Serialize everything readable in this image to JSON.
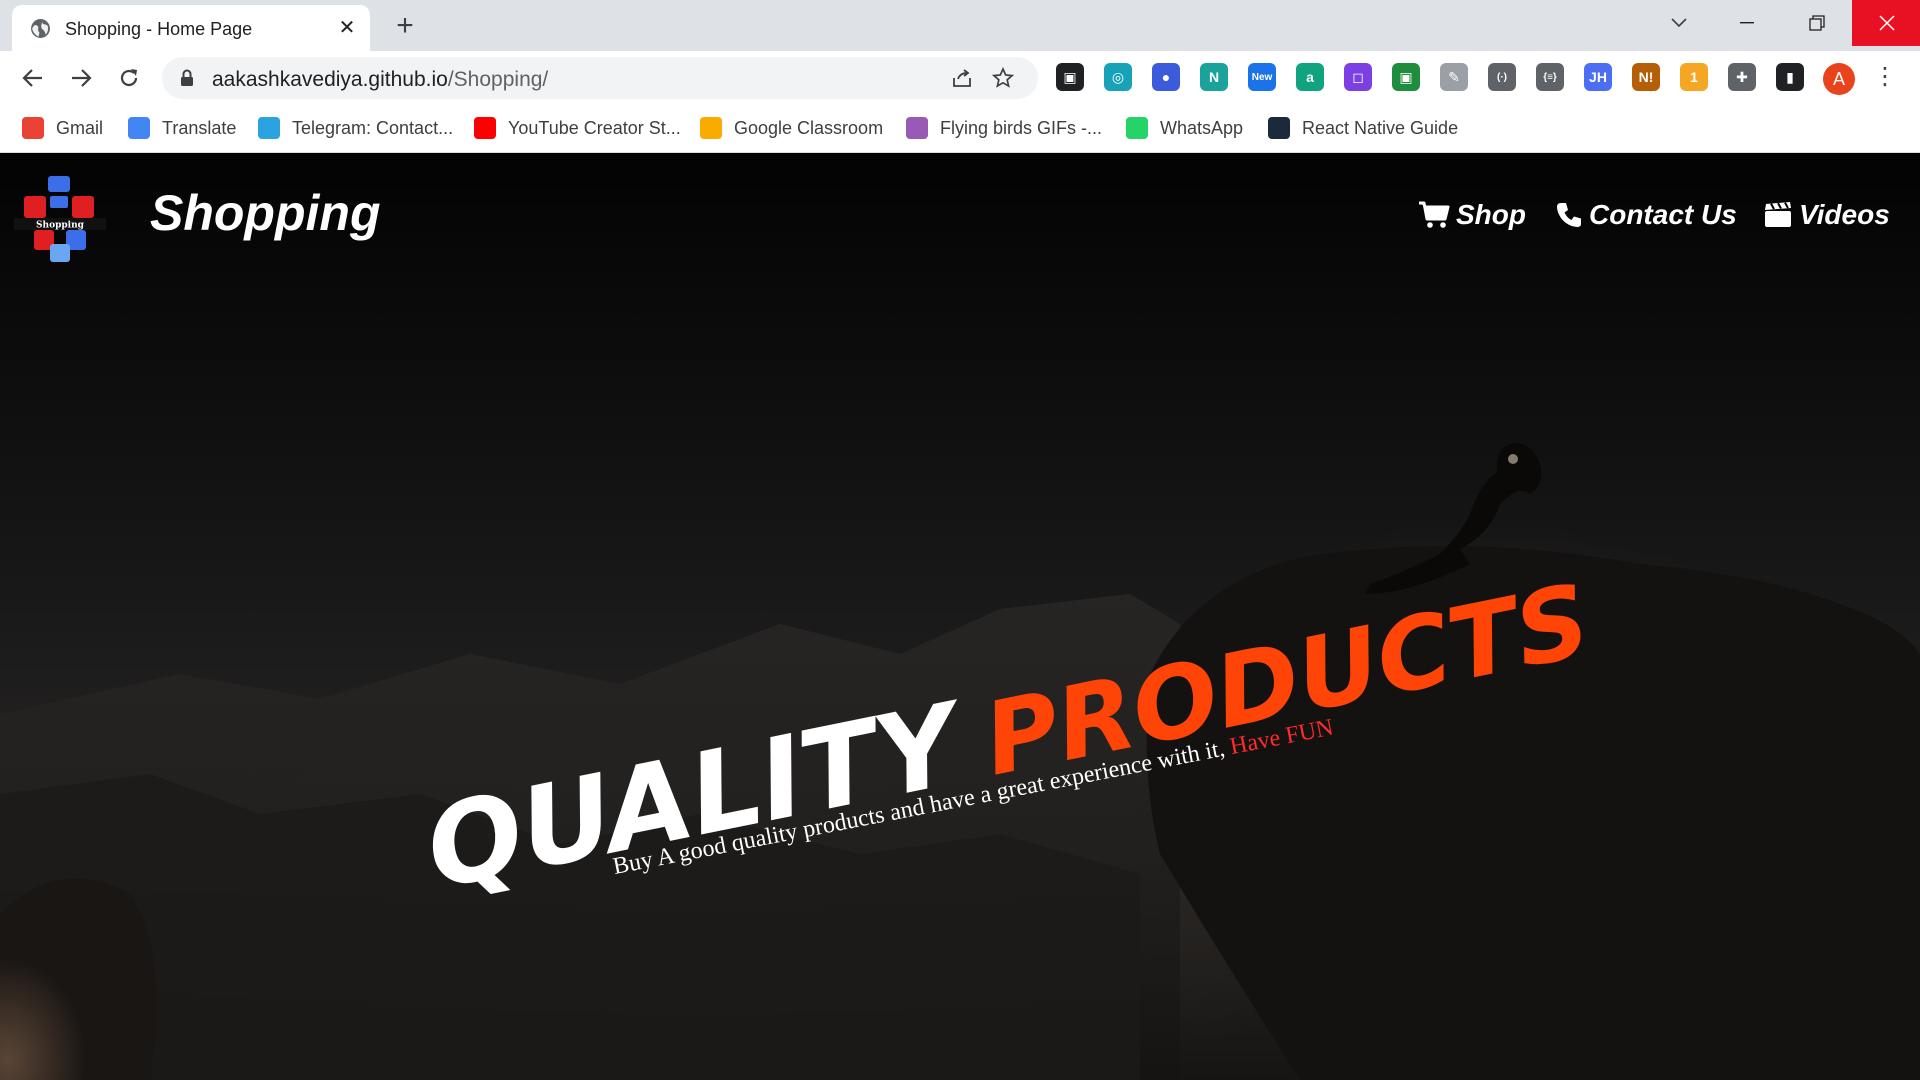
{
  "browser": {
    "tab_title": "Shopping - Home Page",
    "tab_close": "✕",
    "new_tab": "+",
    "url_domain": "aakashkavediya.github.io",
    "url_path": "/Shopping/",
    "extensions": [
      {
        "name": "pip",
        "color": "#202124",
        "label": "▣"
      },
      {
        "name": "ext-swirl",
        "color": "#17a2b8",
        "label": "◎"
      },
      {
        "name": "ext-firefox",
        "color": "#3b5bdb",
        "label": "●"
      },
      {
        "name": "ext-n",
        "color": "#1aa39a",
        "label": "N"
      },
      {
        "name": "ext-new",
        "color": "#1a73e8",
        "label": "New"
      },
      {
        "name": "ext-a",
        "color": "#10a37f",
        "label": "a"
      },
      {
        "name": "ext-purple",
        "color": "#7b3fe4",
        "label": "◻"
      },
      {
        "name": "ext-classroom",
        "color": "#1e8e3e",
        "label": "▣"
      },
      {
        "name": "ext-pen",
        "color": "#9aa0a6",
        "label": "✎"
      },
      {
        "name": "ext-code",
        "color": "#5f6368",
        "label": "(·)"
      },
      {
        "name": "ext-json",
        "color": "#5f6368",
        "label": "{≡}"
      },
      {
        "name": "ext-jh",
        "color": "#4c6ef5",
        "label": "JH"
      },
      {
        "name": "ext-ni",
        "color": "#b45f06",
        "label": "N!"
      },
      {
        "name": "ext-pie",
        "color": "#f5a623",
        "label": "1"
      },
      {
        "name": "ext-puzzle",
        "color": "#5f6368",
        "label": "✚"
      },
      {
        "name": "ext-sidepanel",
        "color": "#202124",
        "label": "▮"
      }
    ],
    "avatar_letter": "A",
    "menu": "⋮"
  },
  "bookmarks": [
    {
      "label": "Gmail",
      "color": "#ea4335"
    },
    {
      "label": "Translate",
      "color": "#4285f4"
    },
    {
      "label": "Telegram: Contact...",
      "color": "#2aa3e0"
    },
    {
      "label": "YouTube Creator St...",
      "color": "#ff0000"
    },
    {
      "label": "Google Classroom",
      "color": "#f9ab00"
    },
    {
      "label": "Flying birds GIFs -...",
      "color": "#9b59b6"
    },
    {
      "label": "WhatsApp",
      "color": "#25d366"
    },
    {
      "label": "React Native Guide",
      "color": "#1b2a3a"
    }
  ],
  "site": {
    "brand": "Shopping",
    "nav": {
      "shop": "Shop",
      "contact": "Contact Us",
      "videos": "Videos"
    },
    "hero": {
      "title_main": "QUALITY",
      "title_accent": "PRODUCTS",
      "subtitle_main": "Buy A good quality products and have a great experience with it, ",
      "subtitle_accent": "Have FUN"
    },
    "colors": {
      "accent": "#ff4408",
      "fun": "#ff2a2a",
      "background": "#000000"
    }
  }
}
